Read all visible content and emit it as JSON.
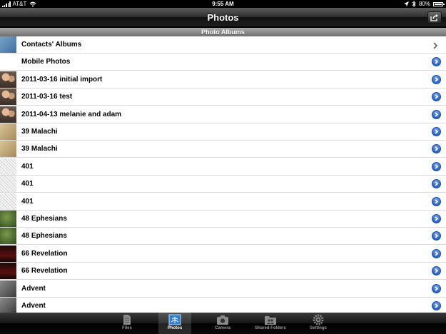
{
  "status": {
    "carrier": "AT&T",
    "time": "9:55 AM",
    "battery": "80%",
    "battery_level": 0.8
  },
  "nav": {
    "title": "Photos"
  },
  "section": {
    "header": "Photo Albums"
  },
  "albums": [
    {
      "label": "Contacts' Albums",
      "accessory": "chevron",
      "thumb": "contacts"
    },
    {
      "label": "Mobile Photos",
      "accessory": "detail",
      "thumb": "none"
    },
    {
      "label": "2011-03-16 initial import",
      "accessory": "detail",
      "thumb": "people"
    },
    {
      "label": "2011-03-16 test",
      "accessory": "detail",
      "thumb": "people"
    },
    {
      "label": "2011-04-13 melanie and adam",
      "accessory": "detail",
      "thumb": "people"
    },
    {
      "label": "39 Malachi",
      "accessory": "detail",
      "thumb": "parchment"
    },
    {
      "label": "39 Malachi",
      "accessory": "detail",
      "thumb": "parchment"
    },
    {
      "label": "401",
      "accessory": "detail",
      "thumb": "sketch"
    },
    {
      "label": "401",
      "accessory": "detail",
      "thumb": "sketch"
    },
    {
      "label": "401",
      "accessory": "detail",
      "thumb": "sketch"
    },
    {
      "label": "48 Ephesians",
      "accessory": "detail",
      "thumb": "green"
    },
    {
      "label": "48 Ephesians",
      "accessory": "detail",
      "thumb": "green"
    },
    {
      "label": "66 Revelation",
      "accessory": "detail",
      "thumb": "dark-red"
    },
    {
      "label": "66 Revelation",
      "accessory": "detail",
      "thumb": "dark-red"
    },
    {
      "label": "Advent",
      "accessory": "detail",
      "thumb": "gray"
    },
    {
      "label": "Advent",
      "accessory": "detail",
      "thumb": "gray"
    }
  ],
  "tabs": [
    {
      "label": "Files",
      "icon": "files-icon",
      "active": false
    },
    {
      "label": "Photos",
      "icon": "photos-icon",
      "active": true
    },
    {
      "label": "Camera",
      "icon": "camera-icon",
      "active": false
    },
    {
      "label": "Shared Folders",
      "icon": "shared-folders-icon",
      "active": false
    },
    {
      "label": "Settings",
      "icon": "settings-icon",
      "active": false
    }
  ],
  "colors": {
    "detail_button": "#2a63c9",
    "nav_bar": "#2c2c2c",
    "section_header": "#8a8a8a"
  }
}
